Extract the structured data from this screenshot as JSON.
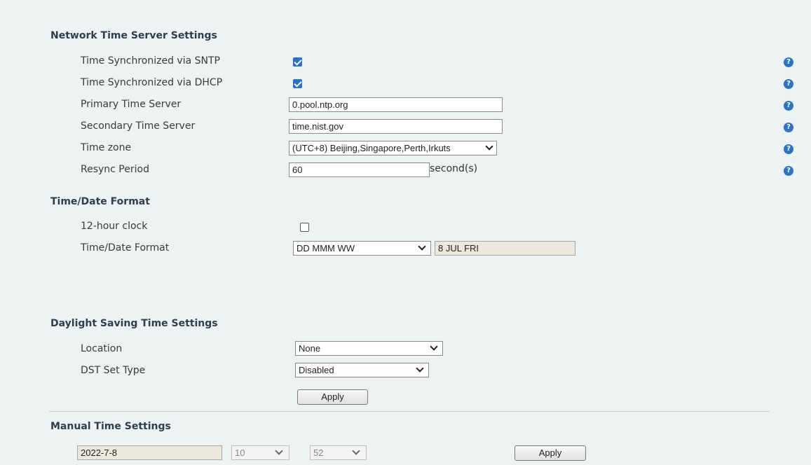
{
  "ntp": {
    "title": "Network Time Server Settings",
    "sntp_label": "Time Synchronized via SNTP",
    "sntp_checked": true,
    "dhcp_label": "Time Synchronized via DHCP",
    "dhcp_checked": true,
    "primary_label": "Primary Time Server",
    "primary_value": "0.pool.ntp.org",
    "secondary_label": "Secondary Time Server",
    "secondary_value": "time.nist.gov",
    "timezone_label": "Time zone",
    "timezone_value": "(UTC+8) Beijing,Singapore,Perth,Irkuts",
    "resync_label": "Resync Period",
    "resync_value": "60",
    "resync_unit": "second(s)",
    "help_icon": "?"
  },
  "format": {
    "title": "Time/Date Format",
    "clock12_label": "12-hour clock",
    "clock12_checked": false,
    "format_label": "Time/Date Format",
    "format_value": "DD MMM WW",
    "format_preview": "8 JUL FRI"
  },
  "dst": {
    "title": "Daylight Saving Time Settings",
    "location_label": "Location",
    "location_value": "None",
    "type_label": "DST Set Type",
    "type_value": "Disabled",
    "apply_label": "Apply"
  },
  "manual": {
    "title": "Manual Time Settings",
    "date_value": "2022-7-8",
    "hour_value": "10",
    "minute_value": "52",
    "apply_label": "Apply"
  },
  "colors": {
    "background": "#edf3f3",
    "accent": "#2473c9"
  },
  "icons": [
    "help-icon",
    "checkbox-checked-icon",
    "chevron-down-icon"
  ]
}
